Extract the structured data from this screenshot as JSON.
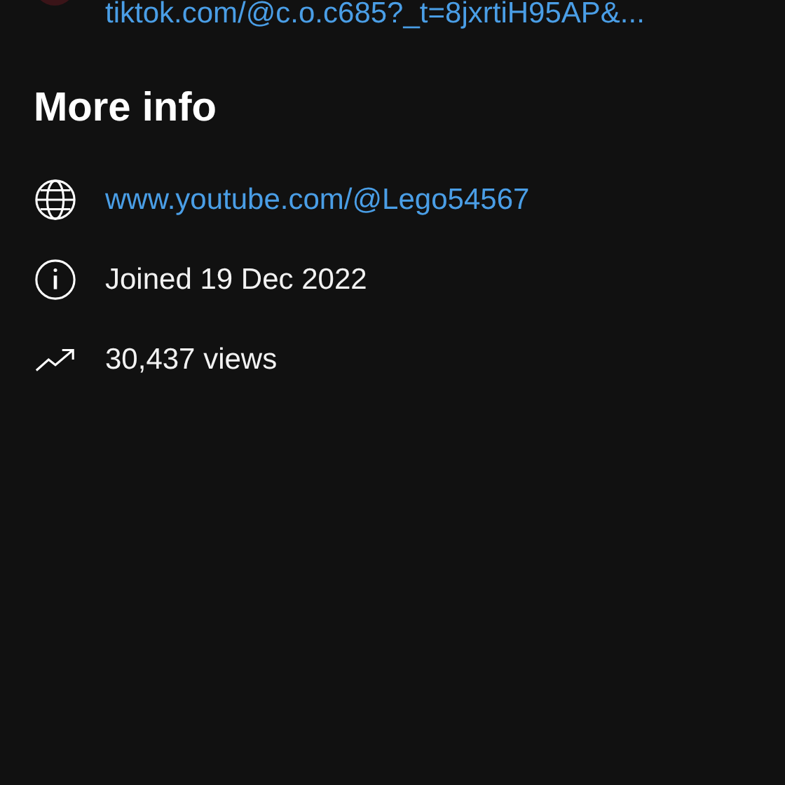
{
  "top_link": {
    "text": "tiktok.com/@c.o.c685?_t=8jxrtiH95AP&..."
  },
  "section": {
    "title": "More info"
  },
  "items": [
    {
      "kind": "link",
      "text": "www.youtube.com/@Lego54567"
    },
    {
      "kind": "joined",
      "text": "Joined 19 Dec 2022"
    },
    {
      "kind": "views",
      "text": "30,437 views"
    }
  ]
}
